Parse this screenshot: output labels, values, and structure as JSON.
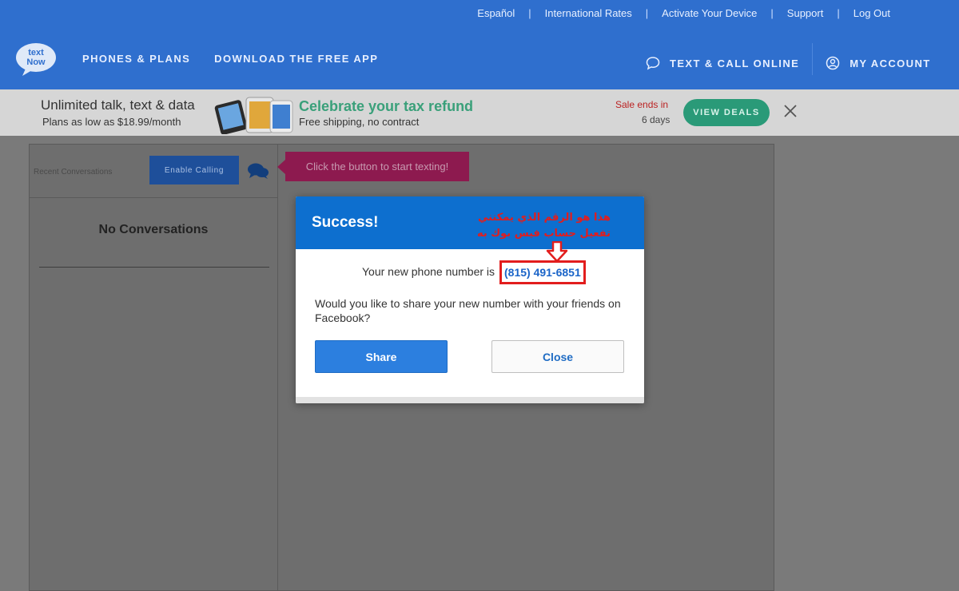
{
  "utility": [
    "Español",
    "International Rates",
    "Activate Your Device",
    "Support",
    "Log Out"
  ],
  "utility_sep": "|",
  "logo_text": "textNow",
  "nav": {
    "phones_plans": "PHONES & PLANS",
    "download_app": "DOWNLOAD THE FREE APP",
    "text_call_online": "TEXT & CALL ONLINE",
    "my_account": "MY ACCOUNT"
  },
  "promo": {
    "headline": "Unlimited talk, text & data",
    "plans": "Plans as low as $18.99/month",
    "celebrate": "Celebrate your tax refund",
    "shipping": "Free shipping, no contract",
    "sale_ends": "Sale ends in",
    "days": "6 days",
    "view_deals": "VIEW DEALS"
  },
  "sidebar": {
    "recent": "Recent Conversations",
    "enable_calling": "Enable Calling",
    "no_conversations": "No Conversations"
  },
  "tooltip": "Click the button to start texting!",
  "modal": {
    "title": "Success!",
    "annotation_line1": "هذا هو الرقم الذي يمكنني",
    "annotation_line2": "تفعيل حساب فيس بوك به",
    "number_prefix": "Your new phone number is",
    "phone_number": "(815) 491-6851",
    "question": "Would you like to share your new number with your friends on Facebook?",
    "share": "Share",
    "close": "Close"
  },
  "colors": {
    "header_blue": "#2f6fce",
    "modal_blue": "#0d6fcf",
    "annotation_red": "#e21d1d",
    "deals_green": "#2a9a78"
  }
}
